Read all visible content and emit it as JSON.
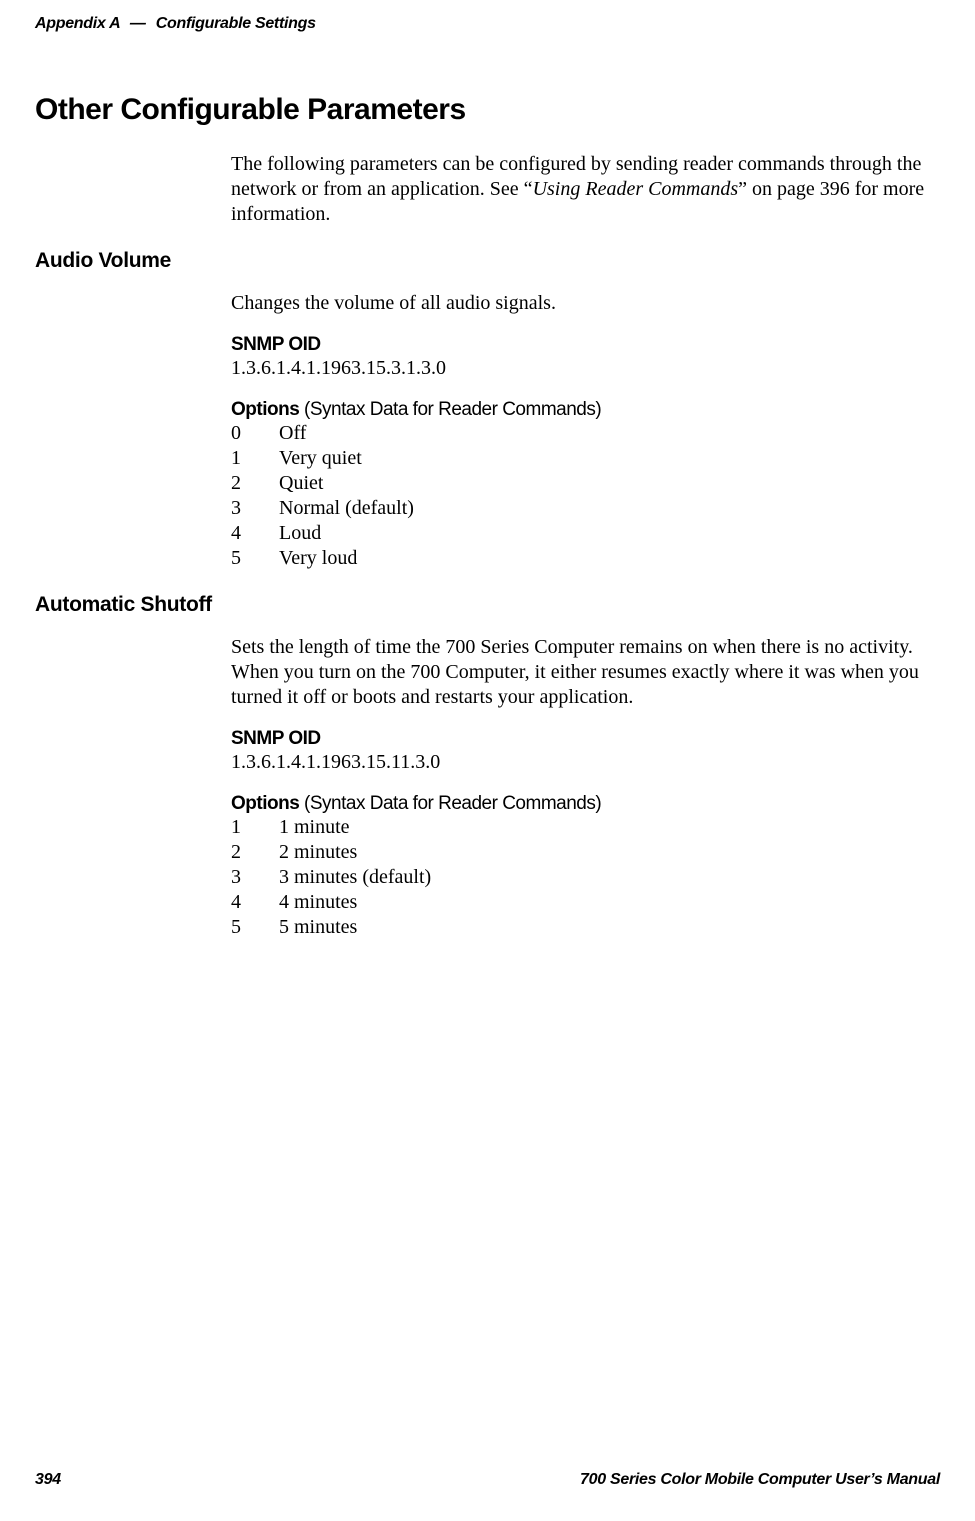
{
  "header": {
    "appendix": "Appendix",
    "letter": "A",
    "sep": "—",
    "title": "Configurable Settings"
  },
  "h1": "Other Configurable Parameters",
  "intro": {
    "pre": "The following parameters can be configured by sending reader commands through the network or from an application. See “",
    "em": "Using Reader Commands",
    "post": "” on page 396 for more information."
  },
  "sections": [
    {
      "heading": "Audio Volume",
      "desc": "Changes the volume of all audio signals.",
      "snmp_label": "SNMP OID",
      "snmp_value": "1.3.6.1.4.1.1963.15.3.1.3.0",
      "options_label_bold": "Options",
      "options_label_rest": " (Syntax Data for Reader Commands)",
      "options": [
        {
          "k": "0",
          "v": "Off"
        },
        {
          "k": "1",
          "v": "Very quiet"
        },
        {
          "k": "2",
          "v": "Quiet"
        },
        {
          "k": "3",
          "v": "Normal (default)"
        },
        {
          "k": "4",
          "v": "Loud"
        },
        {
          "k": "5",
          "v": "Very loud"
        }
      ]
    },
    {
      "heading": "Automatic Shutoff",
      "desc": "Sets the length of time the 700 Series Computer remains on when there is no activity. When you turn on the 700 Computer, it either resumes exactly where it was when you turned it off or boots and restarts your application.",
      "snmp_label": "SNMP OID",
      "snmp_value": "1.3.6.1.4.1.1963.15.11.3.0",
      "options_label_bold": "Options",
      "options_label_rest": " (Syntax Data for Reader Commands)",
      "options": [
        {
          "k": "1",
          "v": "1 minute"
        },
        {
          "k": "2",
          "v": "2 minutes"
        },
        {
          "k": "3",
          "v": "3 minutes (default)"
        },
        {
          "k": "4",
          "v": "4 minutes"
        },
        {
          "k": "5",
          "v": "5 minutes"
        }
      ]
    }
  ],
  "footer": {
    "page": "394",
    "title": "700 Series Color Mobile Computer User’s Manual"
  }
}
